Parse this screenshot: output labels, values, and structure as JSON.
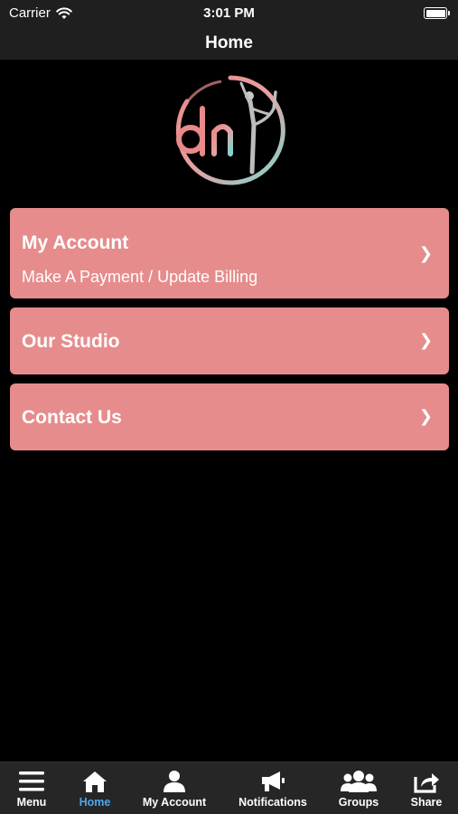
{
  "status_bar": {
    "carrier": "Carrier",
    "time": "3:01 PM"
  },
  "nav": {
    "title": "Home"
  },
  "colors": {
    "card": "#e68c8c",
    "active_tab": "#4aa8f0",
    "background": "#000000",
    "bar": "#1f1f1f"
  },
  "menu": [
    {
      "title": "My Account",
      "subtitle": "Make A Payment / Update Billing"
    },
    {
      "title": "Our Studio"
    },
    {
      "title": "Contact Us"
    }
  ],
  "chevron": "❯",
  "tabs": [
    {
      "label": "Menu",
      "icon": "hamburger-icon"
    },
    {
      "label": "Home",
      "icon": "home-icon",
      "active": true
    },
    {
      "label": "My Account",
      "icon": "person-icon"
    },
    {
      "label": "Notifications",
      "icon": "megaphone-icon"
    },
    {
      "label": "Groups",
      "icon": "group-icon"
    },
    {
      "label": "Share",
      "icon": "share-icon"
    }
  ]
}
